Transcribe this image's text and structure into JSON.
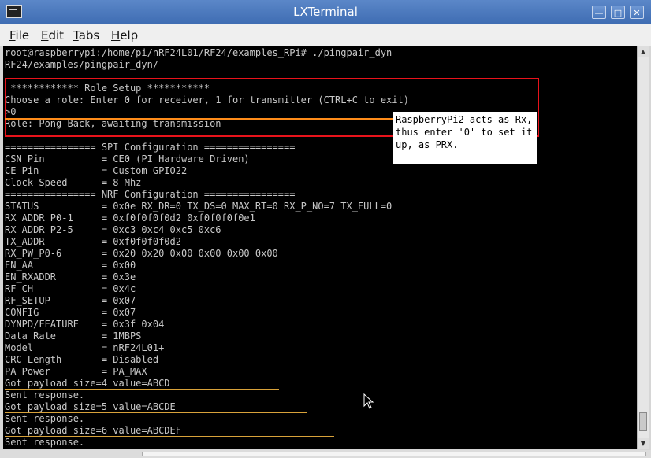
{
  "window": {
    "title": "LXTerminal"
  },
  "menu": [
    {
      "label": "File",
      "mnemonic": "F",
      "rest": "ile"
    },
    {
      "label": "Edit",
      "mnemonic": "E",
      "rest": "dit"
    },
    {
      "label": "Tabs",
      "mnemonic": "T",
      "rest": "abs"
    },
    {
      "label": "Help",
      "mnemonic": "H",
      "rest": "elp"
    }
  ],
  "terminal": {
    "lines": [
      "root@raspberrypi:/home/pi/nRF24L01/RF24/examples_RPi# ./pingpair_dyn",
      "RF24/examples/pingpair_dyn/",
      "",
      " ************ Role Setup ***********",
      "Choose a role: Enter 0 for receiver, 1 for transmitter (CTRL+C to exit)",
      ">0",
      "Role: Pong Back, awaiting transmission",
      "",
      "================ SPI Configuration ================",
      "CSN Pin          = CE0 (PI Hardware Driven)",
      "CE Pin           = Custom GPIO22",
      "Clock Speed      = 8 Mhz",
      "================ NRF Configuration ================",
      "STATUS           = 0x0e RX_DR=0 TX_DS=0 MAX_RT=0 RX_P_NO=7 TX_FULL=0",
      "RX_ADDR_P0-1     = 0xf0f0f0f0d2 0xf0f0f0f0e1",
      "RX_ADDR_P2-5     = 0xc3 0xc4 0xc5 0xc6",
      "TX_ADDR          = 0xf0f0f0f0d2",
      "RX_PW_P0-6       = 0x20 0x20 0x00 0x00 0x00 0x00",
      "EN_AA            = 0x00",
      "EN_RXADDR        = 0x3e",
      "RF_CH            = 0x4c",
      "RF_SETUP         = 0x07",
      "CONFIG           = 0x07",
      "DYNPD/FEATURE    = 0x3f 0x04",
      "Data Rate        = 1MBPS",
      "Model            = nRF24L01+",
      "CRC Length       = Disabled",
      "PA Power         = PA_MAX",
      "Got payload size=4 value=ABCD",
      "Sent response.",
      "Got payload size=5 value=ABCDE",
      "Sent response.",
      "Got payload size=6 value=ABCDEF",
      "Sent response."
    ]
  },
  "annotation": {
    "callout_text": "RaspberryPi2 acts as Rx, thus enter '0' to set it up, as PRX.",
    "box_color": "#e8131b",
    "pointer_color": "#ff8c1a",
    "underline_color": "#d8a23a"
  }
}
